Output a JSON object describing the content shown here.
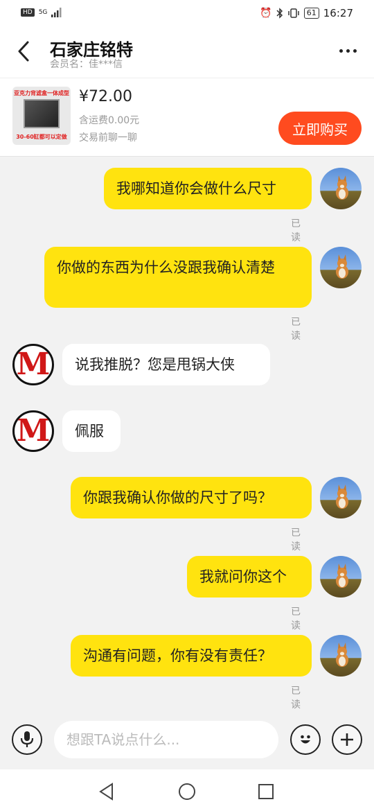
{
  "status_bar": {
    "hd": "HD",
    "network": "5G",
    "battery": "61",
    "time": "16:27"
  },
  "header": {
    "title": "石家庄铭特",
    "member_label": "会员名：佳***信"
  },
  "product": {
    "thumb_top_text": "亚克力背滤盒一体成型",
    "thumb_bottom_text": "30-60缸都可以定做",
    "price": "¥72.00",
    "shipping": "含运费0.00元",
    "chat_hint": "交易前聊一聊",
    "buy_label": "立即购买"
  },
  "messages": [
    {
      "side": "out",
      "text": "我哪知道你会做什么尺寸",
      "status": "已读"
    },
    {
      "side": "out",
      "text": "你做的东西为什么没跟我确认清楚",
      "status": "已读"
    },
    {
      "side": "in",
      "text": "说我推脱？您是甩锅大侠"
    },
    {
      "side": "in",
      "text": "佩服"
    },
    {
      "side": "out",
      "text": "你跟我确认你做的尺寸了吗？",
      "status": "已读"
    },
    {
      "side": "out",
      "text": "我就问你这个",
      "status": "已读"
    },
    {
      "side": "out",
      "text": "沟通有问题，你有没有责任？",
      "status": "已读"
    }
  ],
  "seller_avatar_letter": "M",
  "input": {
    "placeholder": "想跟TA说点什么..."
  },
  "icons": {
    "back": "chevron-left-icon",
    "more": "more-dots-icon",
    "voice": "microphone-icon",
    "emoji": "emoji-icon",
    "add": "plus-icon",
    "nav_back": "triangle-back-icon",
    "nav_home": "circle-home-icon",
    "nav_recent": "square-recent-icon"
  },
  "colors": {
    "outgoing_bubble": "#ffe30f",
    "incoming_bubble": "#ffffff",
    "buy_button": "#ff4b1f",
    "background": "#f2f2f2"
  }
}
